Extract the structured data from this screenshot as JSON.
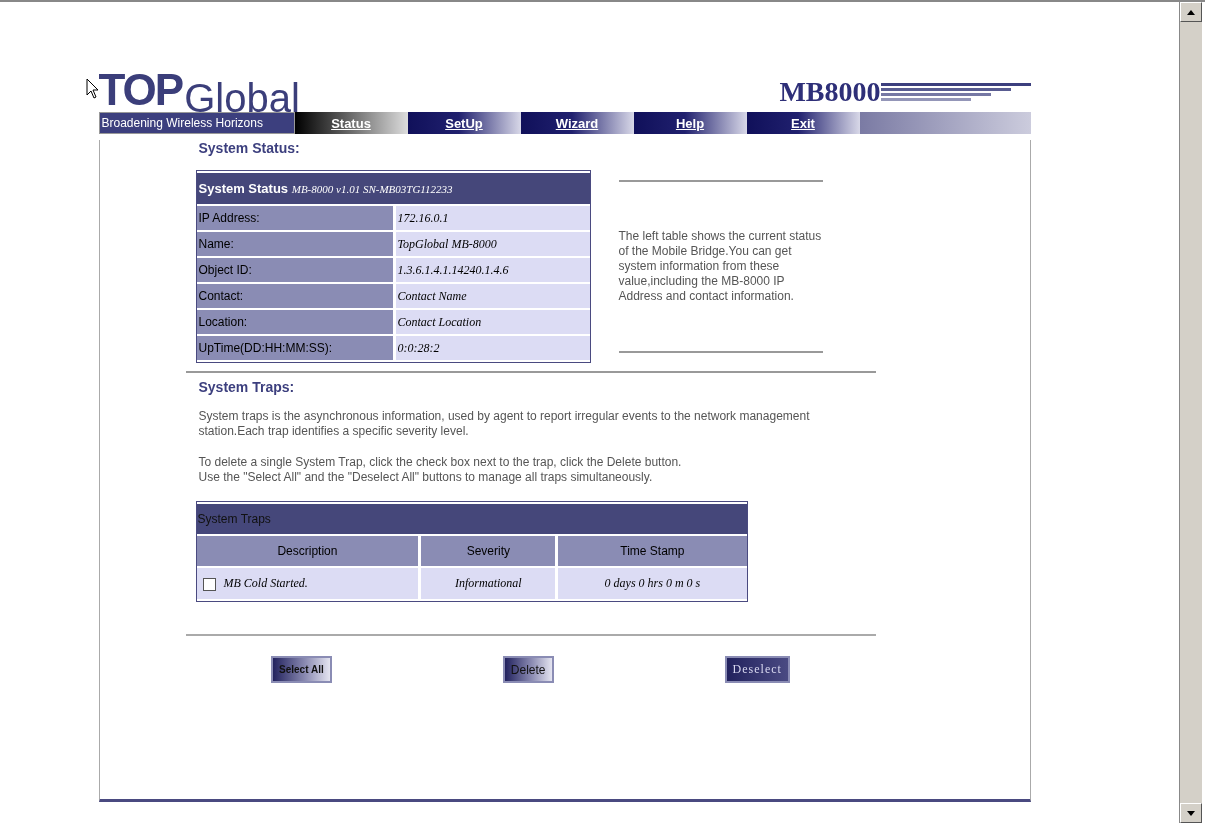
{
  "logo": {
    "top": "TOP",
    "global": "Global",
    "tagline": "Broadening Wireless Horizons"
  },
  "product": "MB8000",
  "nav": [
    {
      "label": "Status",
      "selected": true
    },
    {
      "label": "SetUp",
      "selected": false
    },
    {
      "label": "Wizard",
      "selected": false
    },
    {
      "label": "Help",
      "selected": false
    },
    {
      "label": "Exit",
      "selected": false
    }
  ],
  "status_section": {
    "heading": "System Status:",
    "table": {
      "title": "System Status",
      "subtitle": "MB-8000 v1.01 SN-MB03TG112233",
      "rows": [
        {
          "label": "IP Address:",
          "value": "172.16.0.1"
        },
        {
          "label": "Name:",
          "value": "TopGlobal MB-8000"
        },
        {
          "label": "Object ID:",
          "value": "1.3.6.1.4.1.14240.1.4.6"
        },
        {
          "label": "Contact:",
          "value": "Contact Name"
        },
        {
          "label": "Location:",
          "value": "Contact Location"
        },
        {
          "label": "UpTime(DD:HH:MM:SS):",
          "value": "0:0:28:2"
        }
      ]
    },
    "note": "The left table shows the current status of the Mobile Bridge.You can get system information from these value,including the MB-8000 IP Address and contact information."
  },
  "traps_section": {
    "heading": "System Traps:",
    "paragraphs": [
      "System traps is the asynchronous information, used by agent to report irregular events to the network management station.Each trap identifies a specific severity level.",
      "To delete a single System Trap, click the check box next to the trap, click the Delete button.\nUse the \"Select All\" and the \"Deselect All\" buttons to manage all traps simultaneously."
    ],
    "table": {
      "title": "System Traps",
      "columns": [
        "Description",
        "Severity",
        "Time Stamp"
      ],
      "rows": [
        {
          "description": "MB Cold Started.",
          "severity": "Informational",
          "time_stamp": "0 days 0 hrs 0 m 0 s",
          "checked": false
        }
      ]
    }
  },
  "buttons": [
    {
      "label": "Select All",
      "kind": "small"
    },
    {
      "label": "Delete",
      "kind": "normal"
    },
    {
      "label": "Deselect",
      "kind": "serif"
    }
  ]
}
